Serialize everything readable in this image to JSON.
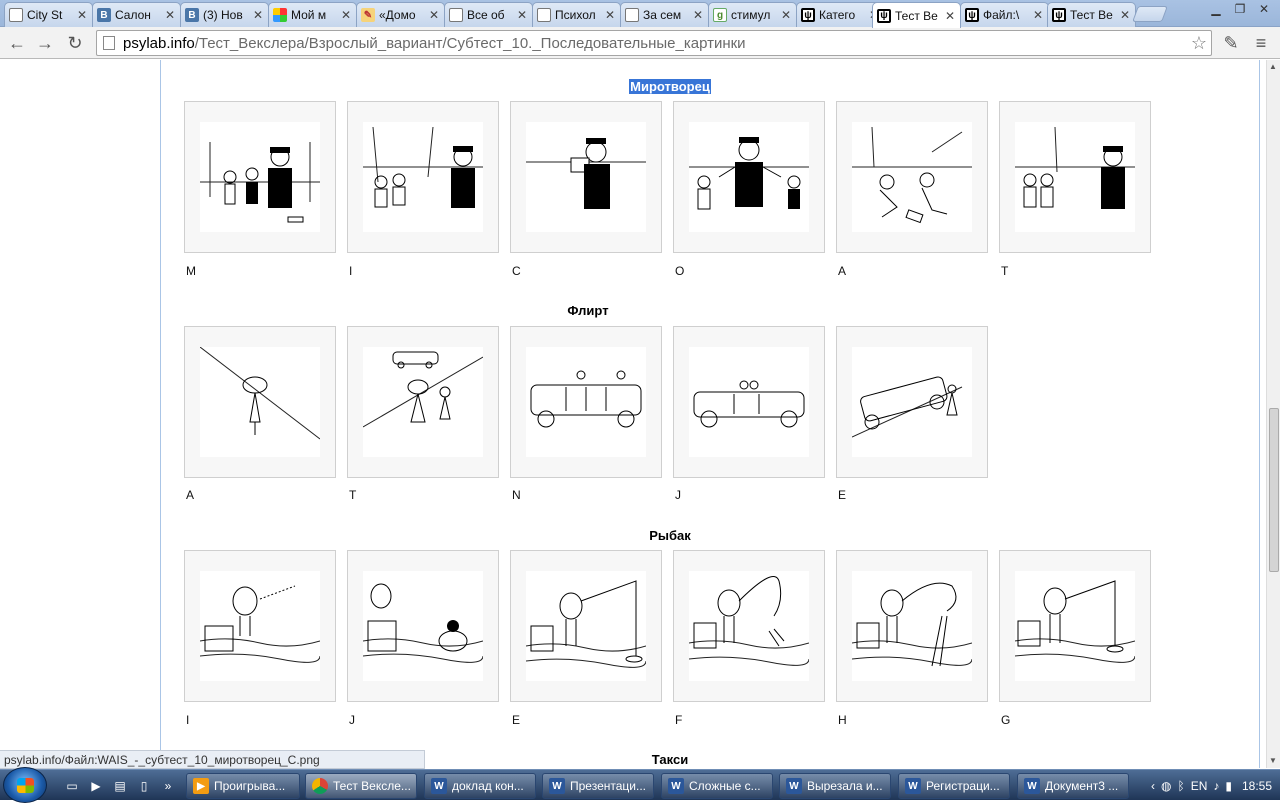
{
  "browser": {
    "tabs": [
      {
        "title": "City St",
        "icon": "doc-icon"
      },
      {
        "title": "Салон",
        "icon": "vk-icon"
      },
      {
        "title": "(3) Нов",
        "icon": "vk-icon"
      },
      {
        "title": "Мой м",
        "icon": "mailru-icon"
      },
      {
        "title": "«Домо",
        "icon": "pen-icon"
      },
      {
        "title": "Все об",
        "icon": "doc-icon"
      },
      {
        "title": "Психол",
        "icon": "doc-icon"
      },
      {
        "title": "За сем",
        "icon": "doc-icon"
      },
      {
        "title": "стимул",
        "icon": "google-icon"
      },
      {
        "title": "Катего",
        "icon": "psylab-icon"
      },
      {
        "title": "Тест Ве",
        "icon": "psylab-icon",
        "active": true
      },
      {
        "title": "Файл:\\",
        "icon": "psylab-icon"
      },
      {
        "title": "Тест Ве",
        "icon": "psylab-icon"
      }
    ],
    "address": {
      "host": "psylab.info",
      "path": "/Тест_Векслера/Взрослый_вариант/Субтест_10._Последовательные_картинки"
    },
    "status_url": "psylab.info/Файл:WAIS_-_субтест_10_миротворец_C.png"
  },
  "page": {
    "sections": [
      {
        "title": "Миротворец",
        "selected": true,
        "captions": [
          "M",
          "I",
          "C",
          "O",
          "A",
          "T"
        ]
      },
      {
        "title": "Флирт",
        "captions": [
          "A",
          "T",
          "N",
          "J",
          "E"
        ]
      },
      {
        "title": "Рыбак",
        "captions": [
          "I",
          "J",
          "E",
          "F",
          "H",
          "G"
        ]
      },
      {
        "title": "Такси"
      }
    ]
  },
  "taskbar": {
    "items": [
      {
        "label": "Проигрыва...",
        "icon": "media-icon"
      },
      {
        "label": "Тест Вексле...",
        "icon": "chrome-icon",
        "active": true
      },
      {
        "label": "доклад кон...",
        "icon": "word-icon"
      },
      {
        "label": "Презентаци...",
        "icon": "word-icon"
      },
      {
        "label": "Сложные с...",
        "icon": "word-icon"
      },
      {
        "label": "Вырезала и...",
        "icon": "word-icon"
      },
      {
        "label": "Регистраци...",
        "icon": "word-icon"
      },
      {
        "label": "Документ3 ...",
        "icon": "word-icon"
      }
    ],
    "tray_lang": "EN",
    "clock": "18:55"
  },
  "colors": {
    "selection": "#3875d7",
    "taskbar": "#1f3556",
    "tab_strip": "#9bb6da"
  }
}
